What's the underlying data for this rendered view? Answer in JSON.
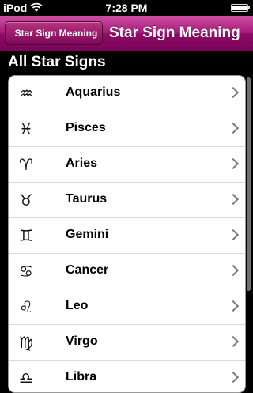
{
  "status_bar": {
    "carrier": "iPod",
    "time": "7:28 PM"
  },
  "nav": {
    "back_label": "Star Sign Meaning",
    "title": "Star Sign Meaning"
  },
  "section": {
    "title": "All Star Signs"
  },
  "signs": [
    {
      "name": "Aquarius",
      "icon": "♒"
    },
    {
      "name": "Pisces",
      "icon": "♓"
    },
    {
      "name": "Aries",
      "icon": "♈"
    },
    {
      "name": "Taurus",
      "icon": "♉"
    },
    {
      "name": "Gemini",
      "icon": "♊"
    },
    {
      "name": "Cancer",
      "icon": "♋"
    },
    {
      "name": "Leo",
      "icon": "♌"
    },
    {
      "name": "Virgo",
      "icon": "♍"
    },
    {
      "name": "Libra",
      "icon": "♎"
    }
  ],
  "colors": {
    "nav_accent": "#a6177a",
    "background": "#000000"
  }
}
